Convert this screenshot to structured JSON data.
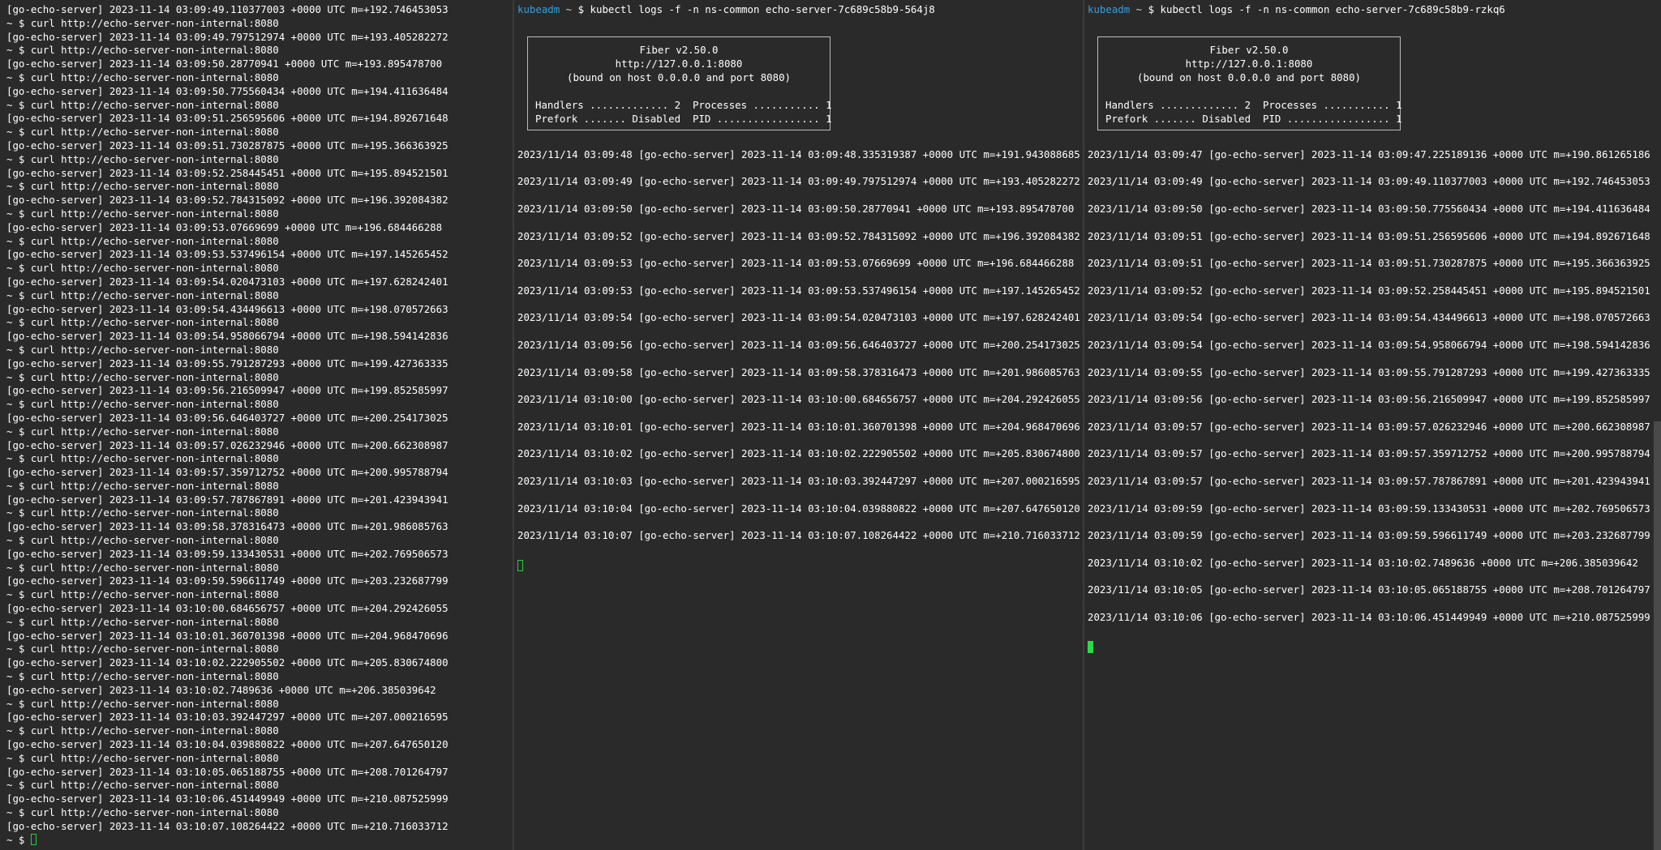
{
  "left_pane": {
    "lines": [
      "[go-echo-server] 2023-11-14 03:09:49.110377003 +0000 UTC m=+192.746453053",
      "~ $ curl http://echo-server-non-internal:8080",
      "[go-echo-server] 2023-11-14 03:09:49.797512974 +0000 UTC m=+193.405282272",
      "~ $ curl http://echo-server-non-internal:8080",
      "[go-echo-server] 2023-11-14 03:09:50.28770941 +0000 UTC m=+193.895478700",
      "~ $ curl http://echo-server-non-internal:8080",
      "[go-echo-server] 2023-11-14 03:09:50.775560434 +0000 UTC m=+194.411636484",
      "~ $ curl http://echo-server-non-internal:8080",
      "[go-echo-server] 2023-11-14 03:09:51.256595606 +0000 UTC m=+194.892671648",
      "~ $ curl http://echo-server-non-internal:8080",
      "[go-echo-server] 2023-11-14 03:09:51.730287875 +0000 UTC m=+195.366363925",
      "~ $ curl http://echo-server-non-internal:8080",
      "[go-echo-server] 2023-11-14 03:09:52.258445451 +0000 UTC m=+195.894521501",
      "~ $ curl http://echo-server-non-internal:8080",
      "[go-echo-server] 2023-11-14 03:09:52.784315092 +0000 UTC m=+196.392084382",
      "~ $ curl http://echo-server-non-internal:8080",
      "[go-echo-server] 2023-11-14 03:09:53.07669699 +0000 UTC m=+196.684466288",
      "~ $ curl http://echo-server-non-internal:8080",
      "[go-echo-server] 2023-11-14 03:09:53.537496154 +0000 UTC m=+197.145265452",
      "~ $ curl http://echo-server-non-internal:8080",
      "[go-echo-server] 2023-11-14 03:09:54.020473103 +0000 UTC m=+197.628242401",
      "~ $ curl http://echo-server-non-internal:8080",
      "[go-echo-server] 2023-11-14 03:09:54.434496613 +0000 UTC m=+198.070572663",
      "~ $ curl http://echo-server-non-internal:8080",
      "[go-echo-server] 2023-11-14 03:09:54.958066794 +0000 UTC m=+198.594142836",
      "~ $ curl http://echo-server-non-internal:8080",
      "[go-echo-server] 2023-11-14 03:09:55.791287293 +0000 UTC m=+199.427363335",
      "~ $ curl http://echo-server-non-internal:8080",
      "[go-echo-server] 2023-11-14 03:09:56.216509947 +0000 UTC m=+199.852585997",
      "~ $ curl http://echo-server-non-internal:8080",
      "[go-echo-server] 2023-11-14 03:09:56.646403727 +0000 UTC m=+200.254173025",
      "~ $ curl http://echo-server-non-internal:8080",
      "[go-echo-server] 2023-11-14 03:09:57.026232946 +0000 UTC m=+200.662308987",
      "~ $ curl http://echo-server-non-internal:8080",
      "[go-echo-server] 2023-11-14 03:09:57.359712752 +0000 UTC m=+200.995788794",
      "~ $ curl http://echo-server-non-internal:8080",
      "[go-echo-server] 2023-11-14 03:09:57.787867891 +0000 UTC m=+201.423943941",
      "~ $ curl http://echo-server-non-internal:8080",
      "[go-echo-server] 2023-11-14 03:09:58.378316473 +0000 UTC m=+201.986085763",
      "~ $ curl http://echo-server-non-internal:8080",
      "[go-echo-server] 2023-11-14 03:09:59.133430531 +0000 UTC m=+202.769506573",
      "~ $ curl http://echo-server-non-internal:8080",
      "[go-echo-server] 2023-11-14 03:09:59.596611749 +0000 UTC m=+203.232687799",
      "~ $ curl http://echo-server-non-internal:8080",
      "[go-echo-server] 2023-11-14 03:10:00.684656757 +0000 UTC m=+204.292426055",
      "~ $ curl http://echo-server-non-internal:8080",
      "[go-echo-server] 2023-11-14 03:10:01.360701398 +0000 UTC m=+204.968470696",
      "~ $ curl http://echo-server-non-internal:8080",
      "[go-echo-server] 2023-11-14 03:10:02.222905502 +0000 UTC m=+205.830674800",
      "~ $ curl http://echo-server-non-internal:8080",
      "[go-echo-server] 2023-11-14 03:10:02.7489636 +0000 UTC m=+206.385039642",
      "~ $ curl http://echo-server-non-internal:8080",
      "[go-echo-server] 2023-11-14 03:10:03.392447297 +0000 UTC m=+207.000216595",
      "~ $ curl http://echo-server-non-internal:8080",
      "[go-echo-server] 2023-11-14 03:10:04.039880822 +0000 UTC m=+207.647650120",
      "~ $ curl http://echo-server-non-internal:8080",
      "[go-echo-server] 2023-11-14 03:10:05.065188755 +0000 UTC m=+208.701264797",
      "~ $ curl http://echo-server-non-internal:8080",
      "[go-echo-server] 2023-11-14 03:10:06.451449949 +0000 UTC m=+210.087525999",
      "~ $ curl http://echo-server-non-internal:8080",
      "[go-echo-server] 2023-11-14 03:10:07.108264422 +0000 UTC m=+210.716033712"
    ],
    "prompt": "~ $ "
  },
  "middle_pane": {
    "prompt_user": "kubeadm",
    "prompt_tilde": " ~ ",
    "prompt_dollar": "$ ",
    "command": "kubectl logs -f -n ns-common echo-server-7c689c58b9-564j8",
    "banner": {
      "title": "Fiber v2.50.0",
      "url": "http://127.0.0.1:8080",
      "bound": "(bound on host 0.0.0.0 and port 8080)",
      "stats_line_1": "Handlers ............. 2  Processes ........... 1",
      "stats_line_2": "Prefork ....... Disabled  PID ................. 1"
    },
    "logs": [
      "2023/11/14 03:09:48 [go-echo-server] 2023-11-14 03:09:48.335319387 +0000 UTC m=+191.943088685",
      "2023/11/14 03:09:49 [go-echo-server] 2023-11-14 03:09:49.797512974 +0000 UTC m=+193.405282272",
      "2023/11/14 03:09:50 [go-echo-server] 2023-11-14 03:09:50.28770941 +0000 UTC m=+193.895478700",
      "2023/11/14 03:09:52 [go-echo-server] 2023-11-14 03:09:52.784315092 +0000 UTC m=+196.392084382",
      "2023/11/14 03:09:53 [go-echo-server] 2023-11-14 03:09:53.07669699 +0000 UTC m=+196.684466288",
      "2023/11/14 03:09:53 [go-echo-server] 2023-11-14 03:09:53.537496154 +0000 UTC m=+197.145265452",
      "2023/11/14 03:09:54 [go-echo-server] 2023-11-14 03:09:54.020473103 +0000 UTC m=+197.628242401",
      "2023/11/14 03:09:56 [go-echo-server] 2023-11-14 03:09:56.646403727 +0000 UTC m=+200.254173025",
      "2023/11/14 03:09:58 [go-echo-server] 2023-11-14 03:09:58.378316473 +0000 UTC m=+201.986085763",
      "2023/11/14 03:10:00 [go-echo-server] 2023-11-14 03:10:00.684656757 +0000 UTC m=+204.292426055",
      "2023/11/14 03:10:01 [go-echo-server] 2023-11-14 03:10:01.360701398 +0000 UTC m=+204.968470696",
      "2023/11/14 03:10:02 [go-echo-server] 2023-11-14 03:10:02.222905502 +0000 UTC m=+205.830674800",
      "2023/11/14 03:10:03 [go-echo-server] 2023-11-14 03:10:03.392447297 +0000 UTC m=+207.000216595",
      "2023/11/14 03:10:04 [go-echo-server] 2023-11-14 03:10:04.039880822 +0000 UTC m=+207.647650120",
      "2023/11/14 03:10:07 [go-echo-server] 2023-11-14 03:10:07.108264422 +0000 UTC m=+210.716033712"
    ]
  },
  "right_pane": {
    "prompt_user": "kubeadm",
    "prompt_tilde": " ~ ",
    "prompt_dollar": "$ ",
    "command": "kubectl logs -f -n ns-common echo-server-7c689c58b9-rzkq6",
    "banner": {
      "title": "Fiber v2.50.0",
      "url": "http://127.0.0.1:8080",
      "bound": "(bound on host 0.0.0.0 and port 8080)",
      "stats_line_1": "Handlers ............. 2  Processes ........... 1",
      "stats_line_2": "Prefork ....... Disabled  PID ................. 1"
    },
    "logs": [
      "2023/11/14 03:09:47 [go-echo-server] 2023-11-14 03:09:47.225189136 +0000 UTC m=+190.861265186",
      "2023/11/14 03:09:49 [go-echo-server] 2023-11-14 03:09:49.110377003 +0000 UTC m=+192.746453053",
      "2023/11/14 03:09:50 [go-echo-server] 2023-11-14 03:09:50.775560434 +0000 UTC m=+194.411636484",
      "2023/11/14 03:09:51 [go-echo-server] 2023-11-14 03:09:51.256595606 +0000 UTC m=+194.892671648",
      "2023/11/14 03:09:51 [go-echo-server] 2023-11-14 03:09:51.730287875 +0000 UTC m=+195.366363925",
      "2023/11/14 03:09:52 [go-echo-server] 2023-11-14 03:09:52.258445451 +0000 UTC m=+195.894521501",
      "2023/11/14 03:09:54 [go-echo-server] 2023-11-14 03:09:54.434496613 +0000 UTC m=+198.070572663",
      "2023/11/14 03:09:54 [go-echo-server] 2023-11-14 03:09:54.958066794 +0000 UTC m=+198.594142836",
      "2023/11/14 03:09:55 [go-echo-server] 2023-11-14 03:09:55.791287293 +0000 UTC m=+199.427363335",
      "2023/11/14 03:09:56 [go-echo-server] 2023-11-14 03:09:56.216509947 +0000 UTC m=+199.852585997",
      "2023/11/14 03:09:57 [go-echo-server] 2023-11-14 03:09:57.026232946 +0000 UTC m=+200.662308987",
      "2023/11/14 03:09:57 [go-echo-server] 2023-11-14 03:09:57.359712752 +0000 UTC m=+200.995788794",
      "2023/11/14 03:09:57 [go-echo-server] 2023-11-14 03:09:57.787867891 +0000 UTC m=+201.423943941",
      "2023/11/14 03:09:59 [go-echo-server] 2023-11-14 03:09:59.133430531 +0000 UTC m=+202.769506573",
      "2023/11/14 03:09:59 [go-echo-server] 2023-11-14 03:09:59.596611749 +0000 UTC m=+203.232687799",
      "2023/11/14 03:10:02 [go-echo-server] 2023-11-14 03:10:02.7489636 +0000 UTC m=+206.385039642",
      "2023/11/14 03:10:05 [go-echo-server] 2023-11-14 03:10:05.065188755 +0000 UTC m=+208.701264797",
      "2023/11/14 03:10:06 [go-echo-server] 2023-11-14 03:10:06.451449949 +0000 UTC m=+210.087525999"
    ]
  },
  "colors": {
    "background": "#2a2a2a",
    "text": "#ffffff",
    "prompt_user": "#3b9edd",
    "cursor": "#2bd94a",
    "divider": "#3c3c3c"
  },
  "icons": {
    "cursor_left": "hollow-block-cursor",
    "cursor_middle": "hollow-block-cursor",
    "cursor_right": "solid-block-cursor"
  }
}
